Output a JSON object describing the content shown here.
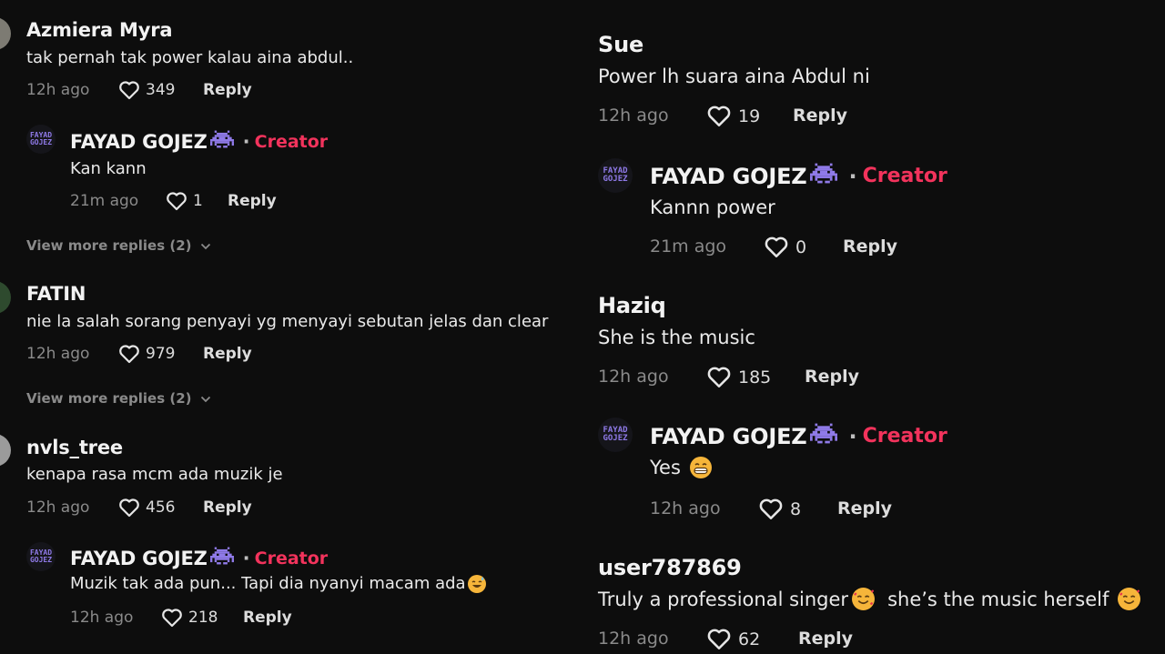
{
  "left": {
    "c1": {
      "name": "Azmiera Myra",
      "text": "tak pernah tak power kalau aina abdul..",
      "time": "12h ago",
      "likes": "349",
      "reply": "Reply"
    },
    "r1": {
      "name": "FAYAD GOJEZ",
      "badge": "Creator",
      "text": "Kan kann",
      "time": "21m ago",
      "likes": "1",
      "reply": "Reply"
    },
    "more1": "View more replies (2)",
    "c2": {
      "name": "FATIN",
      "text": "nie la salah sorang penyayi yg menyayi sebutan jelas dan clear",
      "time": "12h ago",
      "likes": "979",
      "reply": "Reply"
    },
    "more2": "View more replies (2)",
    "c3": {
      "name": "nvls_tree",
      "text": "kenapa rasa mcm ada muzik je",
      "time": "12h ago",
      "likes": "456",
      "reply": "Reply"
    },
    "r3": {
      "name": "FAYAD GOJEZ",
      "badge": "Creator",
      "text": "Muzik tak ada pun... Tapi dia nyanyi macam ada",
      "time": "12h ago",
      "likes": "218",
      "reply": "Reply"
    }
  },
  "right": {
    "c1": {
      "name": "Sue",
      "text": "Power lh suara aina Abdul ni",
      "time": "12h ago",
      "likes": "19",
      "reply": "Reply"
    },
    "r1": {
      "name": "FAYAD GOJEZ",
      "badge": "Creator",
      "text": "Kannn power",
      "time": "21m ago",
      "likes": "0",
      "reply": "Reply"
    },
    "c2": {
      "name": "Haziq",
      "text": "She is the music",
      "time": "12h ago",
      "likes": "185",
      "reply": "Reply"
    },
    "r2": {
      "name": "FAYAD GOJEZ",
      "badge": "Creator",
      "text": "Yes",
      "time": "12h ago",
      "likes": "8",
      "reply": "Reply"
    },
    "c3": {
      "name": "user787869",
      "text_a": "Truly a professional singer",
      "text_b": "she’s the music herself",
      "time": "12h ago",
      "likes": "62",
      "reply": "Reply"
    }
  },
  "separator": "·",
  "logo_text": [
    "FAYAD",
    "GOJEZ"
  ],
  "icons": {
    "heart": "heart-outline-icon",
    "chevron": "chevron-down-icon",
    "invader": "space-invader-emoji-icon",
    "sweat_smile": "sweat-smile-emoji-icon",
    "grin": "grinning-emoji-icon",
    "hearts_face": "smiling-face-with-hearts-emoji-icon"
  },
  "colors": {
    "background": "#0d0d0d",
    "creator": "#f2335c",
    "meta": "#8a8a8a",
    "invader": "#8f7ae8",
    "emoji": "#f6b53a"
  }
}
